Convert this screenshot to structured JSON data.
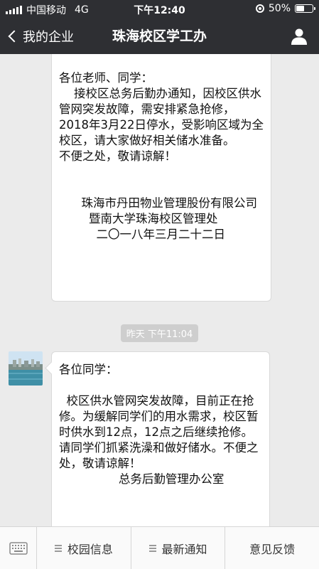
{
  "status_bar": {
    "carrier": "中国移动",
    "network": "4G",
    "time": "下午12:40",
    "battery": "50%",
    "battery_level": 0.5
  },
  "nav": {
    "back_label": "我的企业",
    "title": "珠海校区学工办"
  },
  "messages": [
    {
      "text": "各位老师、同学：\n    接校区总务后勤办通知，因校区供水管网突发故障，需安排紧急抢修，2018年3月22日停水，受影响区域为全校区，请大家做好相关储水准备。\n不便之处，敬请谅解！\n\n\n      珠海市丹田物业管理股份有限公司\n        暨南大学珠海校区管理处\n          二〇一八年三月二十二日"
    },
    {
      "timestamp": "昨天 下午11:04",
      "text": "各位同学：\n\n  校区供水管网突发故障，目前正在抢修。为缓解同学们的用水需求，校区暂时供水到12点，12点之后继续抢修。请同学们抓紧洗澡和做好储水。不便之处，敬请谅解！\n                总务后勤管理办公室"
    }
  ],
  "bottom_menu": {
    "items": [
      {
        "label": "校园信息",
        "icon": "menu-lines-icon"
      },
      {
        "label": "最新通知",
        "icon": "menu-lines-icon"
      },
      {
        "label": "意见反馈",
        "icon": ""
      }
    ]
  },
  "colors": {
    "header_bg": "#2e2f33",
    "chat_bg": "#ebebeb",
    "bubble_bg": "#ffffff"
  }
}
